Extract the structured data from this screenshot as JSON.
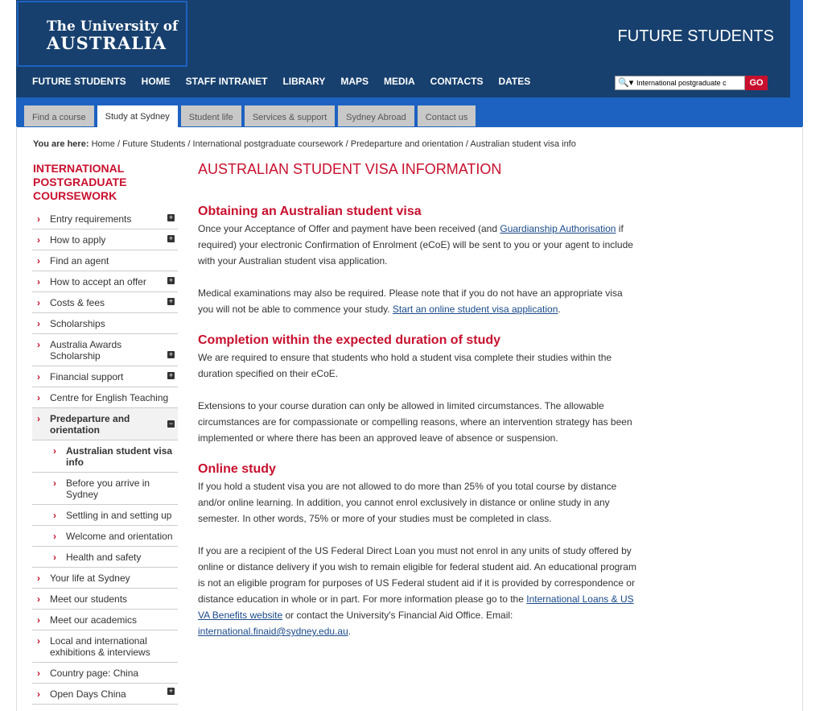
{
  "brand": {
    "line1": "The University of",
    "line2": "AUSTRALIA"
  },
  "header": {
    "section_title": "FUTURE STUDENTS"
  },
  "main_nav": [
    "FUTURE STUDENTS",
    "HOME",
    "STAFF INTRANET",
    "LIBRARY",
    "MAPS",
    "MEDIA",
    "CONTACTS",
    "DATES"
  ],
  "search": {
    "value": "International postgraduate c",
    "go_label": "GO"
  },
  "tabs": [
    "Find a course",
    "Study at Sydney",
    "Student life",
    "Services & support",
    "Sydney Abroad",
    "Contact us"
  ],
  "breadcrumb": {
    "prefix": "You are here:",
    "trail": "Home / Future Students / International postgraduate coursework / Predeparture and orientation / Australian student visa info"
  },
  "sidebar": {
    "title": "INTERNATIONAL POSTGRADUATE COURSEWORK",
    "items": [
      "Entry requirements",
      "How to apply",
      "Find an agent",
      "How to accept an offer",
      "Costs & fees",
      "Scholarships",
      "Australia Awards Scholarship",
      "Financial support",
      "Centre for English Teaching",
      "Predeparture and orientation",
      "Australian student visa info",
      "Before you arrive in Sydney",
      "Settling in and setting up",
      "Welcome and orientation",
      "Health and safety",
      "Your life at Sydney",
      "Meet our students",
      "Meet our academics",
      "Local and international exhibitions & interviews",
      "Country page: China",
      "Open Days China"
    ]
  },
  "content": {
    "title": "AUSTRALIAN STUDENT VISA INFORMATION",
    "s1_heading": "Obtaining an Australian student visa",
    "s1_p1_a": "Once your Acceptance of Offer and payment have been received (and ",
    "s1_p1_link": "Guardianship Authorisation",
    "s1_p1_b": " if required) your electronic Confirmation of Enrolment (eCoE) will be sent to you or your agent to include with your Australian student visa application.",
    "s1_p2_a": "Medical examinations may also be required. Please note that if you do not have an appropriate visa you will not be able to commence your study. ",
    "s1_p2_link": "Start an online student visa application",
    "s1_p2_b": ".",
    "s2_heading": "Completion within the expected duration of study",
    "s2_p1": "We are required to ensure that students who hold a student visa complete their studies within the duration specified on their eCoE.",
    "s2_p2": "Extensions to your course duration can only be allowed in limited circumstances. The allowable circumstances are for compassionate or compelling reasons, where an intervention strategy has been implemented or where there has been an approved leave of absence or suspension.",
    "s3_heading": "Online study",
    "s3_p1": "If you hold a student visa you are not allowed to do more than 25% of you total course by distance and/or online learning. In addition, you cannot enrol exclusively in distance or online study in any semester. In other words, 75% or more of your studies must be completed in class.",
    "s3_p2_a": "If you are a recipient of the US Federal Direct Loan you must not enrol in any units of study offered by online or distance delivery if you wish to remain eligible for federal student aid. An educational program is not an eligible program for purposes of US Federal student aid if it is provided by correspondence or distance education in whole or in part. For more information please go to the ",
    "s3_p2_link1": "International Loans & US VA Benefits website",
    "s3_p2_b": " or contact the University's Financial Aid Office. Email: ",
    "s3_p2_link2": "international.finaid@sydney.edu.au",
    "s3_p2_c": "."
  }
}
